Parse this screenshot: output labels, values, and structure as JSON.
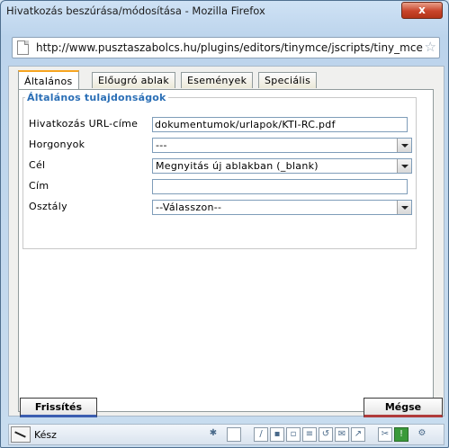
{
  "window": {
    "title": "Hivatkozás beszúrása/módosítása - Mozilla Firefox",
    "close_label": "x"
  },
  "address": {
    "url": "http://www.pusztaszabolcs.hu/plugins/editors/tinymce/jscripts/tiny_mce/pluc"
  },
  "tabs": [
    {
      "label": "Általános",
      "active": true
    },
    {
      "label": "Előugró ablak",
      "active": false
    },
    {
      "label": "Események",
      "active": false
    },
    {
      "label": "Speciális",
      "active": false
    }
  ],
  "section": {
    "legend": "Általános tulajdonságok"
  },
  "fields": {
    "url_label": "Hivatkozás URL-címe",
    "url_value": "dokumentumok/urlapok/KTI-RC.pdf",
    "anchors_label": "Horgonyok",
    "anchors_value": "---",
    "target_label": "Cél",
    "target_value": "Megnyitás új ablakban (_blank)",
    "title_label": "Cím",
    "title_value": "",
    "class_label": "Osztály",
    "class_value": "--Válasszon--"
  },
  "buttons": {
    "update_label": "Frissítés",
    "cancel_label": "Mégse"
  },
  "status": {
    "text": "Kész"
  },
  "colors": {
    "active_tab_accent": "#f7a520",
    "legend": "#2b6fb6",
    "close_button": "#c8442a"
  }
}
